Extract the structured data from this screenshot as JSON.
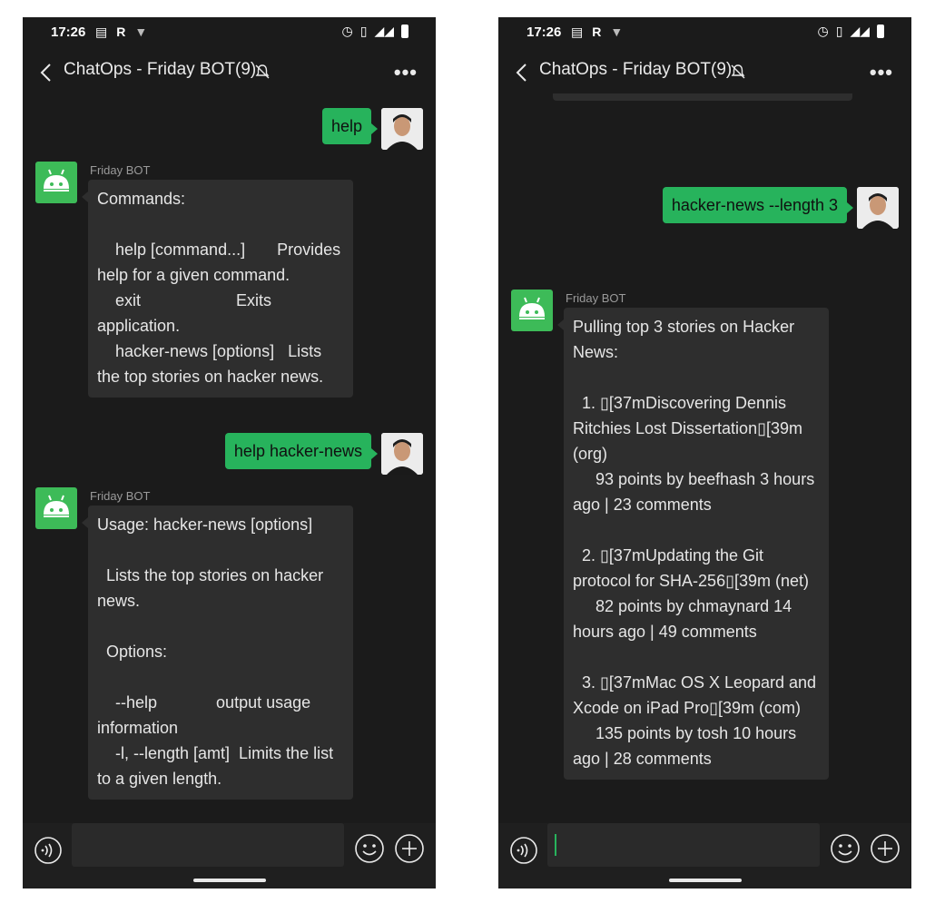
{
  "status": {
    "time": "17:26"
  },
  "header": {
    "title": "ChatOps - Friday BOT(9)"
  },
  "bot": {
    "name": "Friday BOT"
  },
  "left": {
    "msg1": "help",
    "msg2": "Commands:\n\n    help [command...]       Provides help for a given command.\n    exit                     Exits application.\n    hacker-news [options]   Lists the top stories on hacker news.",
    "msg3": "help hacker-news",
    "msg4": "Usage: hacker-news [options]\n\n  Lists the top stories on hacker news.\n\n  Options:\n\n    --help             output usage information\n    -l, --length [amt]  Limits the list to a given length."
  },
  "right": {
    "msg1": "hacker-news --length 3",
    "msg2": "Pulling top 3 stories on Hacker News:\n\n  1. ▯[37mDiscovering Dennis Ritchies Lost Dissertation▯[39m (org)\n     93 points by beefhash 3 hours ago | 23 comments\n\n  2. ▯[37mUpdating the Git protocol for SHA-256▯[39m (net)\n     82 points by chmaynard 14 hours ago | 49 comments\n\n  3. ▯[37mMac OS X Leopard and Xcode on iPad Pro▯[39m (com)\n     135 points by tosh 10 hours ago | 28 comments"
  },
  "colors": {
    "accent": "#27b35c",
    "bot_bubble": "#2e2e2e",
    "background": "#1b1b1b"
  }
}
